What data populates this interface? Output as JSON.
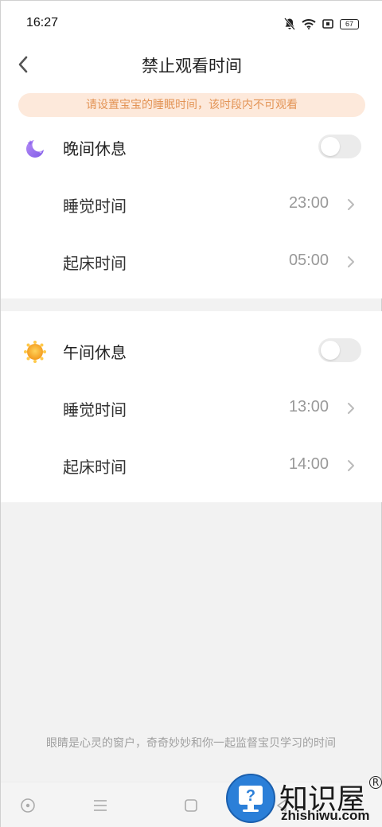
{
  "status_bar": {
    "time": "16:27",
    "battery": "67",
    "icons": [
      "bell-muted-icon",
      "wifi-icon",
      "sim-icon",
      "battery-icon"
    ]
  },
  "header": {
    "title": "禁止观看时间",
    "back_icon": "chevron-left-icon"
  },
  "notice": {
    "text": "请设置宝宝的睡眠时间，该时段内不可观看"
  },
  "night_rest": {
    "title": "晚间休息",
    "icon": "moon-icon",
    "enabled": false,
    "items": [
      {
        "label": "睡觉时间",
        "value": "23:00"
      },
      {
        "label": "起床时间",
        "value": "05:00"
      }
    ]
  },
  "noon_rest": {
    "title": "午间休息",
    "icon": "sun-icon",
    "enabled": false,
    "items": [
      {
        "label": "睡觉时间",
        "value": "13:00"
      },
      {
        "label": "起床时间",
        "value": "14:00"
      }
    ]
  },
  "footer": {
    "text": "眼睛是心灵的窗户，奇奇妙妙和你一起监督宝贝学习的时间"
  },
  "watermark": {
    "title": "知识屋",
    "url": "zhishiwu.com",
    "reg": "R"
  },
  "colors": {
    "accent": "#e39456",
    "notice_bg": "#fde9db",
    "moon": "#9b6ef0",
    "sun": "#f5a623"
  }
}
